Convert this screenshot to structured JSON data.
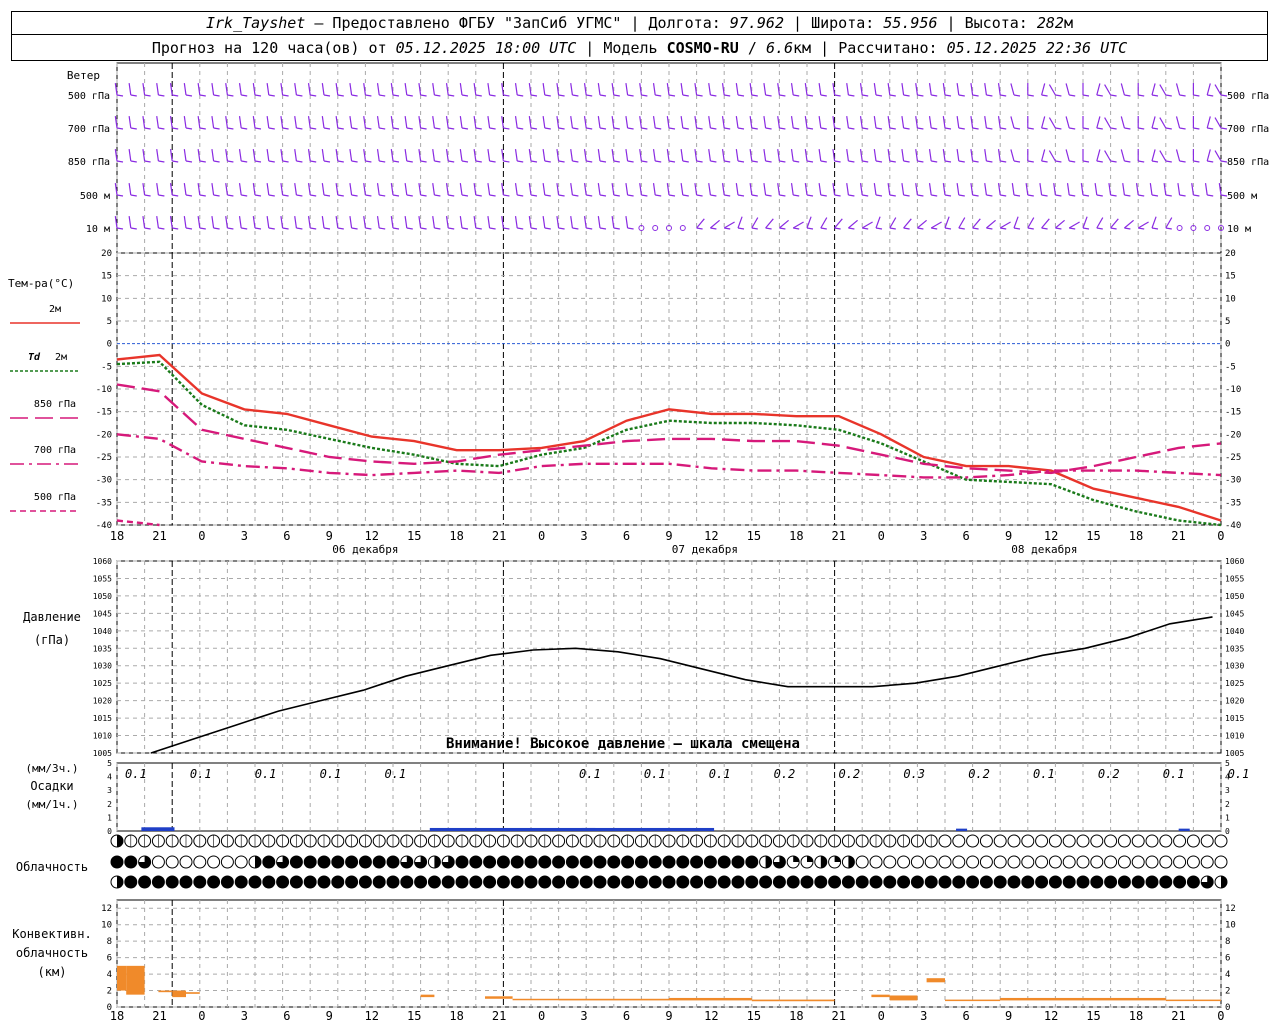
{
  "header": {
    "station": "Irk_Tayshet",
    "provider": "— Предоставлено ФГБУ \"ЗапСиб УГМС\"",
    "lon_label": "Долгота:",
    "lon": "97.962",
    "lat_label": "Широта:",
    "lat": "55.956",
    "alt_label": "Высота:",
    "alt": "282",
    "alt_unit": "м",
    "forecast_label": "Прогноз на 120 часа(ов) от",
    "forecast_start": "05.12.2025 18:00 UTC",
    "model_label": "Модель",
    "model": "COSMO-RU",
    "resolution": "6.6",
    "resolution_unit": "км",
    "computed_label": "Рассчитано:",
    "computed": "05.12.2025 22:36 UTC"
  },
  "chart_data": [
    {
      "type": "line",
      "panel": "wind",
      "row_labels_left": [
        "Ветер",
        "500 гПа",
        "700 гПа",
        "850 гПа",
        "500 м",
        "10 м"
      ],
      "row_labels_right": [
        "500 гПа",
        "700 гПа",
        "850 гПа",
        "500 м",
        "10 м"
      ],
      "colors": {
        "barbs": "#8a2be2"
      }
    },
    {
      "type": "line",
      "panel": "temperature",
      "ylabel": "Тем-ра(°C)",
      "ylim": [
        -40,
        20
      ],
      "yticks": [
        20,
        15,
        10,
        5,
        0,
        -5,
        -10,
        -15,
        -20,
        -25,
        -30,
        -35,
        -40
      ],
      "x": [
        0,
        3,
        6,
        9,
        12,
        15,
        18,
        21,
        24,
        27,
        30,
        33,
        36,
        39,
        42,
        45,
        48,
        51,
        54,
        57,
        60,
        63,
        66,
        69,
        72,
        75,
        78,
        81,
        84,
        87,
        90,
        93,
        96,
        99,
        102,
        105,
        108,
        111,
        114,
        117,
        120
      ],
      "x_tick_labels": [
        "18",
        "21",
        "0",
        "3",
        "6",
        "9",
        "12",
        "15",
        "18",
        "21",
        "0",
        "3",
        "6",
        "9",
        "12",
        "15",
        "18",
        "21",
        "0",
        "3",
        "6",
        "9",
        "12",
        "15",
        "18",
        "21",
        "0"
      ],
      "date_labels": [
        "06 декабря",
        "07 декабря",
        "08 декабря"
      ],
      "series": [
        {
          "name": "2м",
          "color": "#e8342a",
          "dash": "solid",
          "values": [
            -3.5,
            -2.5,
            -11,
            -14.5,
            -15.5,
            -18,
            -20.5,
            -21.5,
            -23.5,
            -23.5,
            -23,
            -21.5,
            -17,
            -14.5,
            -15.5,
            -15.5,
            -16,
            -16,
            -20,
            -25,
            -27,
            -27,
            -28,
            -32,
            -34,
            -36,
            -39
          ]
        },
        {
          "name": "Td 2м",
          "color": "#1a7a1a",
          "dash": "dotted",
          "values": [
            -4.5,
            -4,
            -13.5,
            -18,
            -19,
            -21,
            -23,
            -24.5,
            -26.5,
            -27,
            -24.5,
            -23,
            -19,
            -17,
            -17.5,
            -17.5,
            -18,
            -19,
            -22,
            -26,
            -30,
            -30.5,
            -31,
            -34.5,
            -37,
            -39,
            -40
          ]
        },
        {
          "name": "850 гПа",
          "color": "#d6197a",
          "dash": "longdash",
          "values": [
            -9,
            -10.5,
            -19,
            -21,
            -23,
            -25,
            -26,
            -26.5,
            -26,
            -24.5,
            -23.5,
            -22.5,
            -21.5,
            -21,
            -21,
            -21.5,
            -21.5,
            -22.5,
            -24.5,
            -26.5,
            -27.5,
            -28,
            -28.5,
            -27,
            -25,
            -23,
            -22
          ]
        },
        {
          "name": "700 гПа",
          "color": "#d6197a",
          "dash": "dashdot",
          "values": [
            -20,
            -21,
            -26,
            -27,
            -27.5,
            -28.5,
            -29,
            -28.5,
            -28,
            -28.5,
            -27,
            -26.5,
            -26.5,
            -26.5,
            -27.5,
            -28,
            -28,
            -28.5,
            -29,
            -29.5,
            -29.5,
            -29,
            -28,
            -28,
            -28,
            -28.5,
            -29
          ]
        },
        {
          "name": "500 гПа",
          "color": "#d6197a",
          "dash": "dashed",
          "values": [
            -39,
            -40,
            null,
            null,
            null,
            null,
            null,
            null,
            null,
            null,
            null,
            null,
            null,
            null,
            null,
            null,
            null,
            null,
            null,
            null,
            null,
            null,
            null,
            null,
            null,
            null,
            null
          ]
        }
      ]
    },
    {
      "type": "line",
      "panel": "pressure",
      "ylabel": "Давление",
      "yunit": "(гПа)",
      "ylim": [
        1005,
        1060
      ],
      "yticks": [
        1060,
        1055,
        1050,
        1045,
        1040,
        1035,
        1030,
        1025,
        1020,
        1015,
        1010,
        1005
      ],
      "warning": "Внимание! Высокое давление – шкала смещена",
      "series": [
        {
          "name": "pressure",
          "color": "#000000",
          "values": [
            1005,
            1009,
            1013,
            1017,
            1020,
            1023,
            1027,
            1030,
            1033,
            1034.5,
            1035,
            1034,
            1032,
            1029,
            1026,
            1024,
            1024,
            1024,
            1025,
            1027,
            1030,
            1033,
            1035,
            1038,
            1042,
            1044,
            1045
          ]
        }
      ]
    },
    {
      "type": "bar",
      "panel": "precipitation",
      "ylabel_top": "(мм/3ч.)",
      "ylabel": "Осадки",
      "ylabel_bottom": "(мм/1ч.)",
      "ylim": [
        0,
        5
      ],
      "yticks": [
        "5",
        "4",
        "3",
        "2",
        "1",
        "0"
      ],
      "value_labels": [
        "0.1",
        "0.1",
        "0.1",
        "0.1",
        "0.1",
        "",
        "",
        "0.1",
        "0.1",
        "0.1",
        "0.2",
        "0.2",
        "0.3",
        "0.2",
        "0.1",
        "0.2",
        "0.1",
        "0.1"
      ],
      "value_label_x": [
        3,
        6,
        9,
        12,
        15,
        18,
        21,
        24,
        27,
        30,
        33,
        36,
        39,
        42,
        45,
        48,
        51,
        54
      ],
      "bars_1h": [
        {
          "x": 1.5,
          "len": 3,
          "value": 0.2
        },
        {
          "x": 30,
          "len": 15,
          "value": 0.15
        },
        {
          "x": 45,
          "len": 12,
          "value": 0.15
        },
        {
          "x": 82,
          "len": 1,
          "value": 0.1
        },
        {
          "x": 104,
          "len": 1,
          "value": 0.1
        }
      ],
      "color": "#1f3fc7"
    },
    {
      "type": "table",
      "panel": "cloudiness",
      "ylabel": "Облачность",
      "rows": [
        "high",
        "middle",
        "low"
      ],
      "levels_0_to_8": {
        "high": [
          4,
          0,
          0,
          0,
          0,
          0,
          0,
          0,
          0,
          0,
          0,
          0,
          0,
          0,
          0,
          0,
          0,
          0,
          0,
          0,
          0,
          0,
          0,
          0,
          0,
          0,
          0,
          0,
          0,
          0,
          0,
          0,
          0,
          0,
          0,
          0,
          0,
          0,
          0,
          0,
          0,
          0,
          0,
          0,
          0,
          0,
          0,
          0,
          0,
          0,
          0,
          0,
          0,
          0,
          0,
          0,
          0,
          0,
          0,
          0,
          0,
          0,
          0,
          0,
          0,
          0,
          0,
          0,
          0,
          0,
          0,
          0,
          0,
          0,
          0,
          0,
          0,
          0,
          0,
          0,
          0
        ],
        "middle": [
          8,
          8,
          6,
          0,
          0,
          0,
          0,
          0,
          0,
          0,
          4,
          8,
          6,
          8,
          8,
          8,
          8,
          8,
          8,
          8,
          8,
          6,
          6,
          4,
          6,
          8,
          8,
          8,
          8,
          8,
          8,
          8,
          8,
          8,
          8,
          8,
          8,
          8,
          8,
          8,
          8,
          8,
          8,
          8,
          8,
          8,
          8,
          4,
          6,
          2,
          2,
          4,
          2,
          4,
          0,
          0,
          0,
          0,
          0,
          0,
          0,
          0,
          0,
          0,
          0,
          0,
          0,
          0,
          0,
          0,
          0,
          0,
          0,
          0,
          0,
          0,
          0,
          0,
          0,
          0,
          0
        ],
        "low": [
          4,
          8,
          8,
          8,
          8,
          8,
          8,
          8,
          8,
          8,
          8,
          8,
          8,
          8,
          8,
          8,
          8,
          8,
          8,
          8,
          8,
          8,
          8,
          8,
          8,
          8,
          8,
          8,
          8,
          8,
          8,
          8,
          8,
          8,
          8,
          8,
          8,
          8,
          8,
          8,
          8,
          8,
          8,
          8,
          8,
          8,
          8,
          8,
          8,
          8,
          8,
          8,
          8,
          8,
          8,
          8,
          8,
          8,
          8,
          8,
          8,
          8,
          8,
          8,
          8,
          8,
          8,
          8,
          8,
          8,
          8,
          8,
          8,
          8,
          8,
          8,
          8,
          8,
          8,
          6,
          4
        ]
      }
    },
    {
      "type": "bar",
      "panel": "convective",
      "ylabel_lines": [
        "Конвективн.",
        "облачность",
        "(км)"
      ],
      "ylim": [
        0,
        13
      ],
      "yticks": [
        "12",
        "10",
        "8",
        "6",
        "4",
        "2",
        "0"
      ],
      "color": "#f08a2a",
      "bars": [
        {
          "x0": 0,
          "x1": 1,
          "bottom": 2,
          "top": 5
        },
        {
          "x0": 1,
          "x1": 3,
          "bottom": 1.5,
          "top": 5
        },
        {
          "x0": 4.5,
          "x1": 6,
          "bottom": 1.8,
          "top": 2
        },
        {
          "x0": 6,
          "x1": 7.5,
          "bottom": 1.2,
          "top": 2
        },
        {
          "x0": 7.5,
          "x1": 9,
          "bottom": 1.6,
          "top": 1.8
        },
        {
          "x0": 33,
          "x1": 34.5,
          "bottom": 1.2,
          "top": 1.5
        },
        {
          "x0": 40,
          "x1": 43,
          "bottom": 1,
          "top": 1.3
        },
        {
          "x0": 43,
          "x1": 48,
          "bottom": 0.9,
          "top": 1
        },
        {
          "x0": 48,
          "x1": 60,
          "bottom": 0.8,
          "top": 1
        },
        {
          "x0": 60,
          "x1": 69,
          "bottom": 0.8,
          "top": 1.1
        },
        {
          "x0": 69,
          "x1": 72,
          "bottom": 0.7,
          "top": 0.9
        },
        {
          "x0": 72,
          "x1": 78,
          "bottom": 0.7,
          "top": 0.9
        },
        {
          "x0": 82,
          "x1": 84,
          "bottom": 1.2,
          "top": 1.5
        },
        {
          "x0": 84,
          "x1": 87,
          "bottom": 0.8,
          "top": 1.4
        },
        {
          "x0": 88,
          "x1": 90,
          "bottom": 3,
          "top": 3.5
        },
        {
          "x0": 90,
          "x1": 96,
          "bottom": 0.8,
          "top": 0.9
        },
        {
          "x0": 96,
          "x1": 114,
          "bottom": 0.8,
          "top": 1.1
        },
        {
          "x0": 114,
          "x1": 120,
          "bottom": 0.8,
          "top": 0.9
        }
      ]
    }
  ],
  "legend": {
    "temp_title": "Тем-ра(°C)",
    "t2m": "2м",
    "td": "Td",
    "td2m": "2м",
    "l850": "850 гПа",
    "l700": "700 гПа",
    "l500": "500 гПа"
  }
}
